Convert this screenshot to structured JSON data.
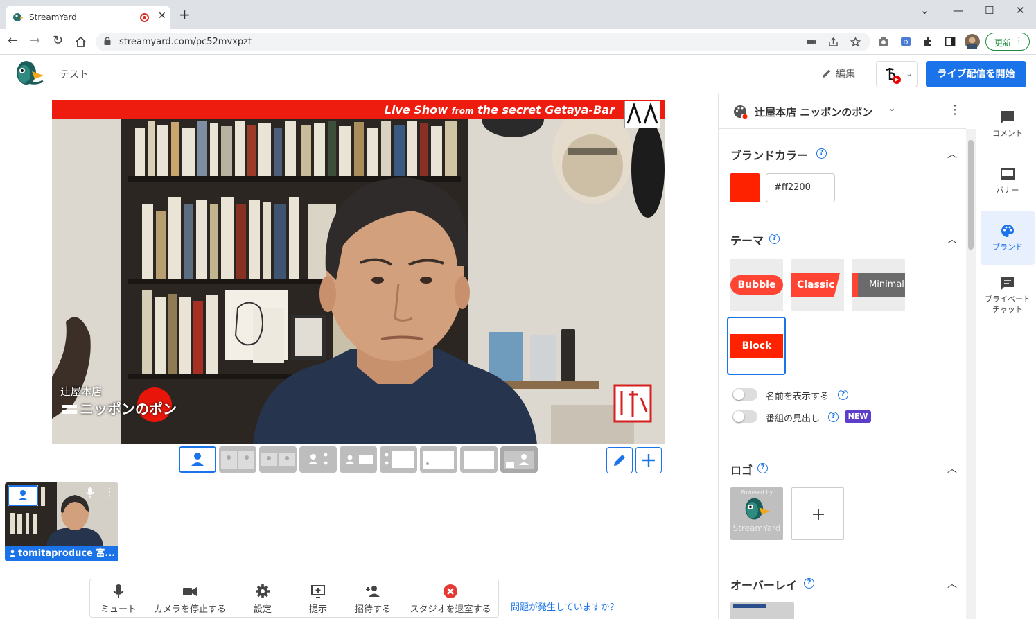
{
  "browser": {
    "tab_title": "StreamYard",
    "url": "streamyard.com/pc52mvxpzt",
    "update_label": "更新"
  },
  "header": {
    "studio_name": "テスト",
    "edit_label": "編集",
    "go_live_label": "ライブ配信を開始"
  },
  "stage": {
    "ticker_main": "Live Show",
    "ticker_from": "from",
    "ticker_rest": "the secret Getaya-Bar",
    "overlay_logo_line1": "辻屋本店",
    "overlay_logo_line2": "ニッポンのポン"
  },
  "self_preview": {
    "name": "tomitaproduce 富..."
  },
  "controls": {
    "mute": "ミュート",
    "camera": "カメラを停止する",
    "settings": "設定",
    "present": "提示",
    "invite": "招待する",
    "leave": "スタジオを退室する",
    "problem_link": "問題が発生していますか？"
  },
  "brand_panel": {
    "brand_name": "辻屋本店 ニッポンのポン",
    "brand_color_title": "ブランドカラー",
    "brand_color_value": "#ff2200",
    "theme_title": "テーマ",
    "themes": [
      "Bubble",
      "Classic",
      "Minimal",
      "Block"
    ],
    "selected_theme": "Block",
    "show_names_label": "名前を表示する",
    "show_headline_label": "番組の見出し",
    "new_badge": "NEW",
    "logo_title": "ロゴ",
    "logo_powered_by": "Powered by",
    "logo_streamyard": "StreamYard",
    "overlay_title": "オーバーレイ"
  },
  "rail": {
    "comments": "コメント",
    "banners": "バナー",
    "brand": "ブランド",
    "private_chat": "プライベートチャット"
  },
  "colors": {
    "accent": "#1a73e8",
    "brand": "#ff2200",
    "ticker": "#ee1c0e",
    "new_badge": "#5c3ec9"
  }
}
